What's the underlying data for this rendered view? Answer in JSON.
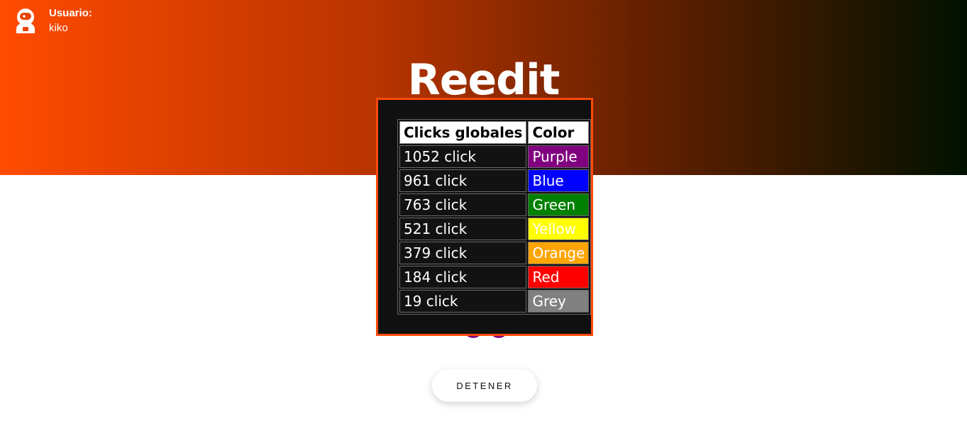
{
  "header": {
    "user_label": "Usuario:",
    "user_name": "kiko",
    "user_icon": "astronaut-icon"
  },
  "title": "Reedit",
  "colors": {
    "gradient_start": "#ff4b00",
    "gradient_end": "#001100",
    "modal_border": "#ff4a0a"
  },
  "table": {
    "headers": [
      "Clicks globales",
      "Color"
    ],
    "rows": [
      {
        "clicks": "1052 click",
        "color": "Purple",
        "swatch": "#800080"
      },
      {
        "clicks": "961 click",
        "color": "Blue",
        "swatch": "#0000ff"
      },
      {
        "clicks": "763 click",
        "color": "Green",
        "swatch": "#008000"
      },
      {
        "clicks": "521 click",
        "color": "Yellow",
        "swatch": "#ffff00"
      },
      {
        "clicks": "379 click",
        "color": "Orange",
        "swatch": "#ffa500"
      },
      {
        "clicks": "184 click",
        "color": "Red",
        "swatch": "#ff0000"
      },
      {
        "clicks": "19 click",
        "color": "Grey",
        "swatch": "#808080"
      }
    ]
  },
  "button": {
    "label": "DETENER"
  }
}
